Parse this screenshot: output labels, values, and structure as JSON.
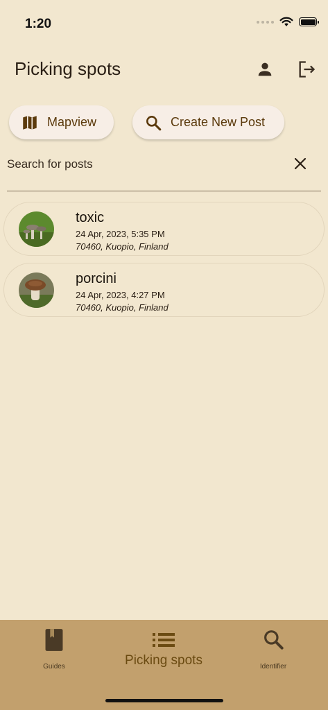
{
  "status_bar": {
    "time": "1:20"
  },
  "header": {
    "title": "Picking spots"
  },
  "actions": {
    "mapview_label": "Mapview",
    "create_label": "Create New Post"
  },
  "search": {
    "placeholder": "Search for posts",
    "value": ""
  },
  "posts": [
    {
      "title": "toxic",
      "datetime": "24 Apr, 2023, 5:35 PM",
      "location": "70460, Kuopio, Finland"
    },
    {
      "title": "porcini",
      "datetime": "24 Apr, 2023, 4:27 PM",
      "location": "70460, Kuopio, Finland"
    }
  ],
  "nav": {
    "items": [
      {
        "label": "Guides",
        "icon": "book-icon",
        "active": false
      },
      {
        "label": "Picking spots",
        "icon": "list-icon",
        "active": true
      },
      {
        "label": "Identifier",
        "icon": "search-icon",
        "active": false
      }
    ]
  },
  "colors": {
    "background": "#f2e7cf",
    "nav_background": "#c2a06d",
    "accent": "#6b4b12",
    "button_background": "#f7eee6"
  }
}
